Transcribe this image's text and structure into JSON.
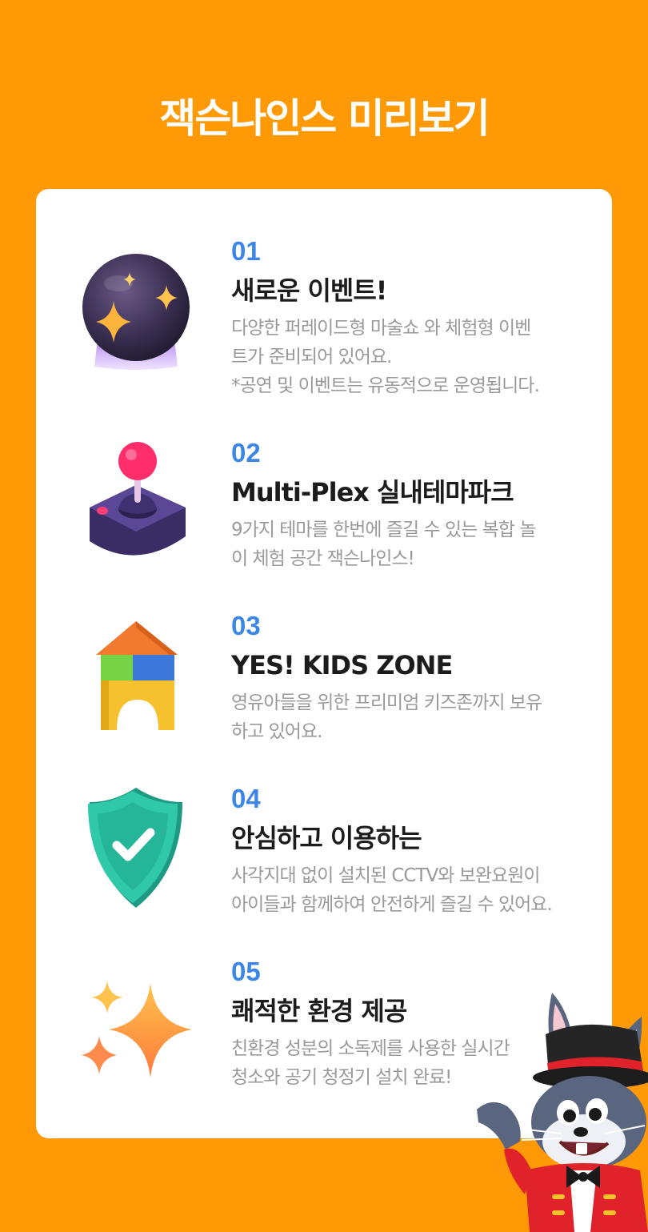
{
  "page": {
    "title": "잭슨나인스 미리보기",
    "background_color": "#FF9A06",
    "accent_color": "#3C86E8"
  },
  "features": [
    {
      "number": "01",
      "title": "새로운 이벤트!",
      "icon": "crystal-ball-icon",
      "description": [
        "다양한 퍼레이드형 마술쇼 와 체험형 이벤",
        "트가 준비되어 있어요.",
        "*공연 및 이벤트는 유동적으로 운영됩니다."
      ]
    },
    {
      "number": "02",
      "title": "Multi-Plex 실내테마파크",
      "icon": "joystick-icon",
      "description": [
        "9가지 테마를 한번에 즐길 수 있는 복합 놀",
        "이 체험 공간 잭슨나인스!"
      ]
    },
    {
      "number": "03",
      "title": "YES! KIDS ZONE",
      "icon": "toy-blocks-icon",
      "description": [
        "영유아들을 위한 프리미엄 키즈존까지 보유",
        "하고 있어요."
      ]
    },
    {
      "number": "04",
      "title": "안심하고 이용하는",
      "icon": "shield-check-icon",
      "description": [
        "사각지대 없이 설치된 CCTV와 보완요원이",
        "아이들과 함께하여 안전하게 즐길 수 있어요."
      ]
    },
    {
      "number": "05",
      "title": "쾌적한 환경 제공",
      "icon": "sparkles-icon",
      "description": [
        "친환경 성분의 소독제를 사용한 실시간",
        "청소와 공기 청정기 설치 완료!"
      ]
    }
  ],
  "mascot": {
    "icon": "rabbit-magician-mascot"
  }
}
